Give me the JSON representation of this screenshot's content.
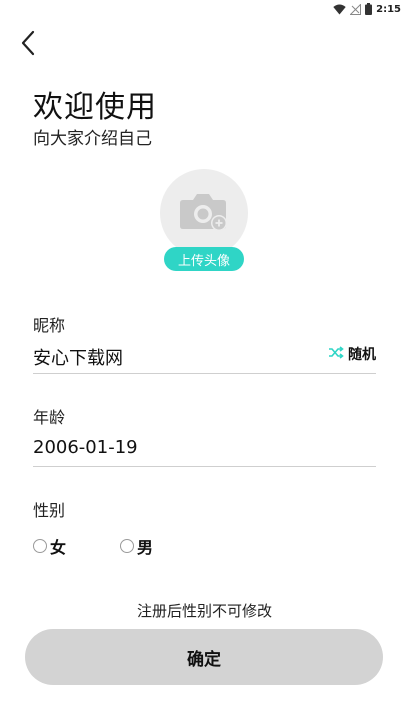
{
  "status_bar": {
    "time": "2:15"
  },
  "header": {
    "title": "欢迎使用",
    "subtitle": "向大家介绍自己"
  },
  "avatar": {
    "upload_label": "上传头像"
  },
  "nickname": {
    "label": "昵称",
    "value": "安心下载网",
    "random_label": "随机"
  },
  "age": {
    "label": "年龄",
    "value": "2006-01-19"
  },
  "gender": {
    "label": "性别",
    "options": [
      "女",
      "男"
    ],
    "selected": null
  },
  "note": "注册后性别不可修改",
  "confirm_label": "确定",
  "colors": {
    "accent": "#2fd5c6",
    "button_bg": "#d3d3d3",
    "avatar_bg": "#ededed"
  }
}
